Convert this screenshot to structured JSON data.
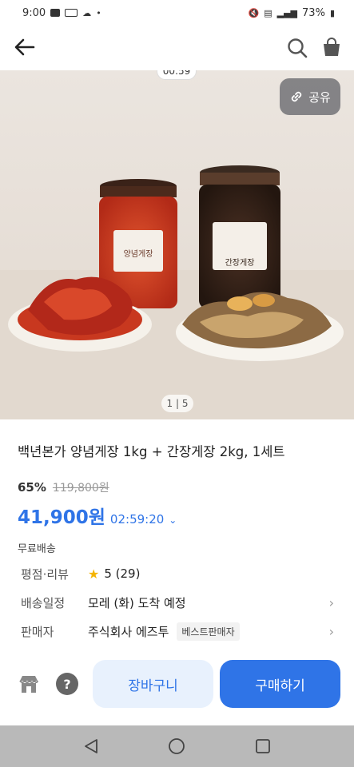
{
  "status_bar": {
    "time": "9:00",
    "battery": "73%"
  },
  "app_bar": {
    "back_icon": "arrow-left-icon",
    "search_icon": "search-icon",
    "cart_icon": "shopping-bag-icon"
  },
  "hero": {
    "timer": "00:59",
    "share_label": "공유",
    "page_indicator": "1 | 5",
    "jar_left_label": "양념게장",
    "jar_right_label": "간장게장"
  },
  "product": {
    "title": "백년본가 양념게장 1kg + 간장게장 2kg, 1세트",
    "discount": "65%",
    "original_price": "119,800원",
    "sale_price": "41,900원",
    "countdown": "02:59:20",
    "shipping": "무료배송"
  },
  "meta": {
    "rating_label": "평점·리뷰",
    "rating_value": "5 (29)",
    "delivery_label": "배송일정",
    "delivery_value": "모레 (화) 도착 예정",
    "seller_label": "판매자",
    "seller_value": "주식회사 에즈투",
    "seller_tag": "베스트판매자"
  },
  "bottom": {
    "cart_label": "장바구니",
    "buy_label": "구매하기",
    "help_label": "?"
  },
  "colors": {
    "accent": "#2f74e7",
    "accent_light": "#e8f1fd"
  }
}
